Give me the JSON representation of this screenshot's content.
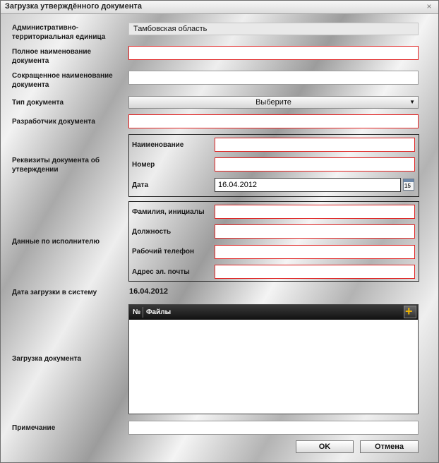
{
  "window": {
    "title": "Загрузка утверждённого документа",
    "close_glyph": "×"
  },
  "form": {
    "admin_unit_label": "Административно-территориальная единица",
    "admin_unit_value": "Тамбовская область",
    "full_name_label": "Полное наименование документа",
    "full_name_value": "",
    "short_name_label": "Сокращенное наименование документа",
    "short_name_value": "",
    "doc_type_label": "Тип документа",
    "doc_type_value": "Выберите",
    "developer_label": "Разработчик документа",
    "developer_value": "",
    "approval": {
      "label": "Реквизиты документа об утверждении",
      "name_label": "Наименование",
      "name_value": "",
      "number_label": "Номер",
      "number_value": "",
      "date_label": "Дата",
      "date_value": "16.04.2012",
      "calendar_number": "15"
    },
    "executor": {
      "label": "Данные по исполнителю",
      "fio_label": "Фамилия, инициалы",
      "fio_value": "",
      "position_label": "Должность",
      "position_value": "",
      "phone_label": "Рабочий телефон",
      "phone_value": "",
      "email_label": "Адрес эл. почты",
      "email_value": ""
    },
    "upload_date_label": "Дата загрузки в систему",
    "upload_date_value": "16.04.2012",
    "upload_label": "Загрузка документа",
    "files_grid": {
      "col_num": "№",
      "col_files": "Файлы",
      "rows": []
    },
    "note_label": "Примечание",
    "note_value": ""
  },
  "footer": {
    "ok_label": "OK",
    "cancel_label": "Отмена"
  },
  "colors": {
    "required_border": "#e02020",
    "grid_header": "#1e1e1e",
    "add_icon": "#f0b400"
  }
}
